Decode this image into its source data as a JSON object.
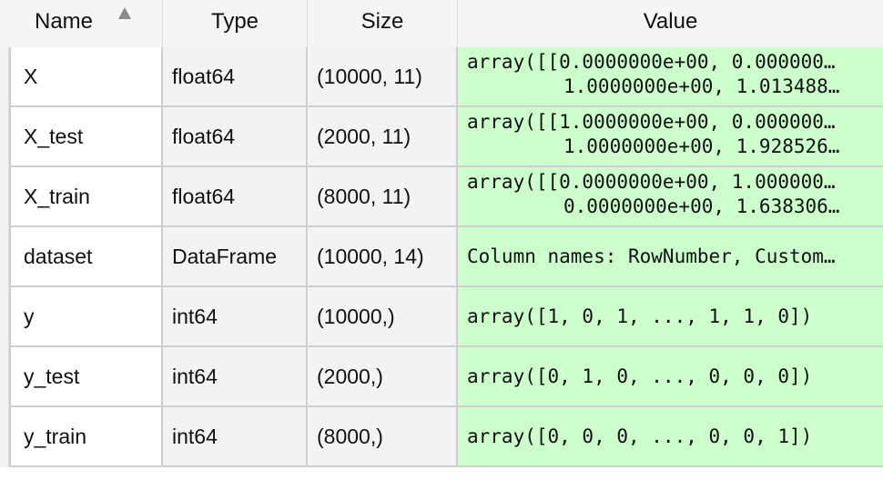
{
  "header": {
    "name": "Name",
    "type": "Type",
    "size": "Size",
    "value": "Value",
    "sort_icon": "sort-ascending-icon"
  },
  "rows": [
    {
      "name": "X",
      "type": "float64",
      "size": "(10000, 11)",
      "value_line1": "array([[0.0000000e+00, 0.000000…",
      "value_line2": "1.0000000e+00, 1.013488…"
    },
    {
      "name": "X_test",
      "type": "float64",
      "size": "(2000, 11)",
      "value_line1": "array([[1.0000000e+00, 0.000000…",
      "value_line2": "1.0000000e+00, 1.928526…"
    },
    {
      "name": "X_train",
      "type": "float64",
      "size": "(8000, 11)",
      "value_line1": "array([[0.0000000e+00, 1.000000…",
      "value_line2": "0.0000000e+00, 1.638306…"
    },
    {
      "name": "dataset",
      "type": "DataFrame",
      "size": "(10000, 14)",
      "value_line1": "Column names: RowNumber, Custom…"
    },
    {
      "name": "y",
      "type": "int64",
      "size": "(10000,)",
      "value_line1": "array([1, 0, 1, ..., 1, 1, 0])"
    },
    {
      "name": "y_test",
      "type": "int64",
      "size": "(2000,)",
      "value_line1": "array([0, 1, 0, ..., 0, 0, 0])"
    },
    {
      "name": "y_train",
      "type": "int64",
      "size": "(8000,)",
      "value_line1": "array([0, 0, 0, ..., 0, 0, 1])"
    }
  ],
  "colors": {
    "header_bg": "#f5f5f5",
    "value_bg": "#ccffcc",
    "type_size_bg": "#f3f3f3",
    "border": "#cfcfcf"
  }
}
